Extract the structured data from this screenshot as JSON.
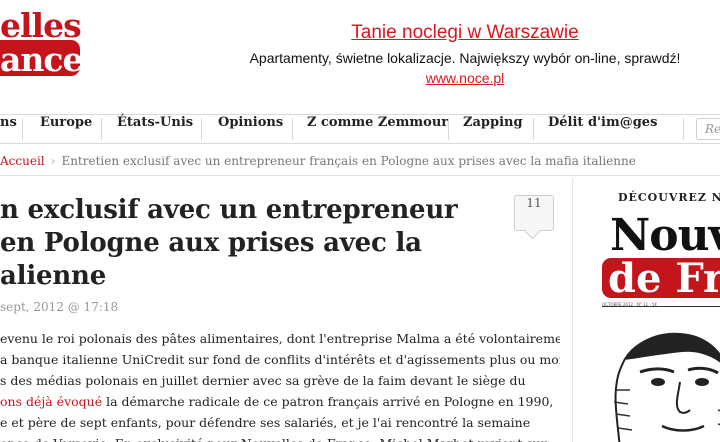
{
  "logo": {
    "line1": "elles",
    "line2": "ance"
  },
  "ad": {
    "title": "Tanie noclegi w Warszawie",
    "description": "Apartamenty, świetne lokalizacje. Największy wybór on-line, sprawdź!",
    "url": "www.noce.pl"
  },
  "nav": {
    "items": [
      "ns",
      "Europe",
      "États-Unis",
      "Opinions",
      "Z comme Zemmour",
      "Zapping",
      "Délit d'im@ges"
    ],
    "search_placeholder": "Re"
  },
  "breadcrumb": {
    "home": "Accueil",
    "current": "Entretien exclusif avec un entrepreneur français en Pologne aux prises avec la mafia italienne"
  },
  "article": {
    "title_lines": [
      "n exclusif avec un entrepreneur",
      "en Pologne aux prises avec la",
      "alienne"
    ],
    "comment_count": "11",
    "date": "sept, 2012 @ 17:18",
    "body": {
      "line1": "evenu le roi polonais des pâtes alimentaires, dont l'entreprise Malma a été volontairement",
      "line2": "a banque italienne UniCredit sur fond de conflits d'intérêts et d'agissements plus ou moins",
      "line3": "s des médias polonais en juillet dernier avec sa grève de la faim devant le siège du",
      "line4_link": "ons déjà évoqué",
      "line4_rest": " la démarche radicale de ce patron français arrivé en Pologne en 1990,",
      "line5": "e et père de sept enfants, pour défendre ses salariés, et je l'ai rencontré la semaine",
      "line6": "ence de Varsovie. En exclusivité pour Nouvelles de France, Michel Marbot revient sur"
    }
  },
  "sidebar": {
    "heading": "DÉCOUVREZ NO",
    "magazine": {
      "line1": "Nouv",
      "line2": "de Fr",
      "meta": "OCTOBRE 2012 · N° 11 · 5€"
    }
  }
}
